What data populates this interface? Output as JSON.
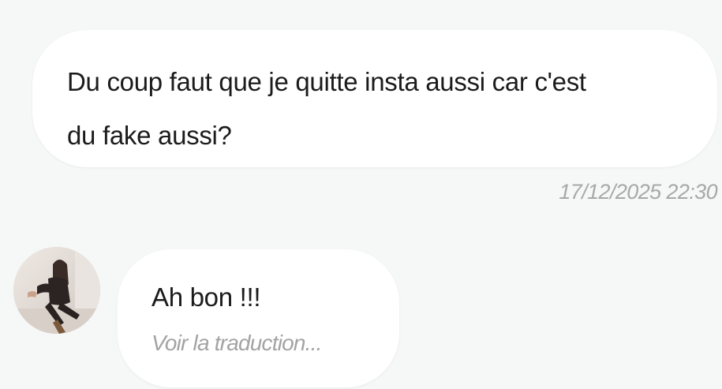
{
  "conversation": {
    "outgoing": {
      "text": "Du coup faut que je quitte insta aussi car c'est\ndu fake aussi?",
      "timestamp": "17/12/2025 22:30"
    },
    "incoming": {
      "avatar_icon": "user-avatar-photo",
      "text": "Ah bon !!!",
      "translate_label": "Voir la traduction..."
    }
  },
  "colors": {
    "background": "#f6f7f7",
    "bubble": "#ffffff",
    "text": "#1b1b1b",
    "muted": "#a8a8a8"
  }
}
